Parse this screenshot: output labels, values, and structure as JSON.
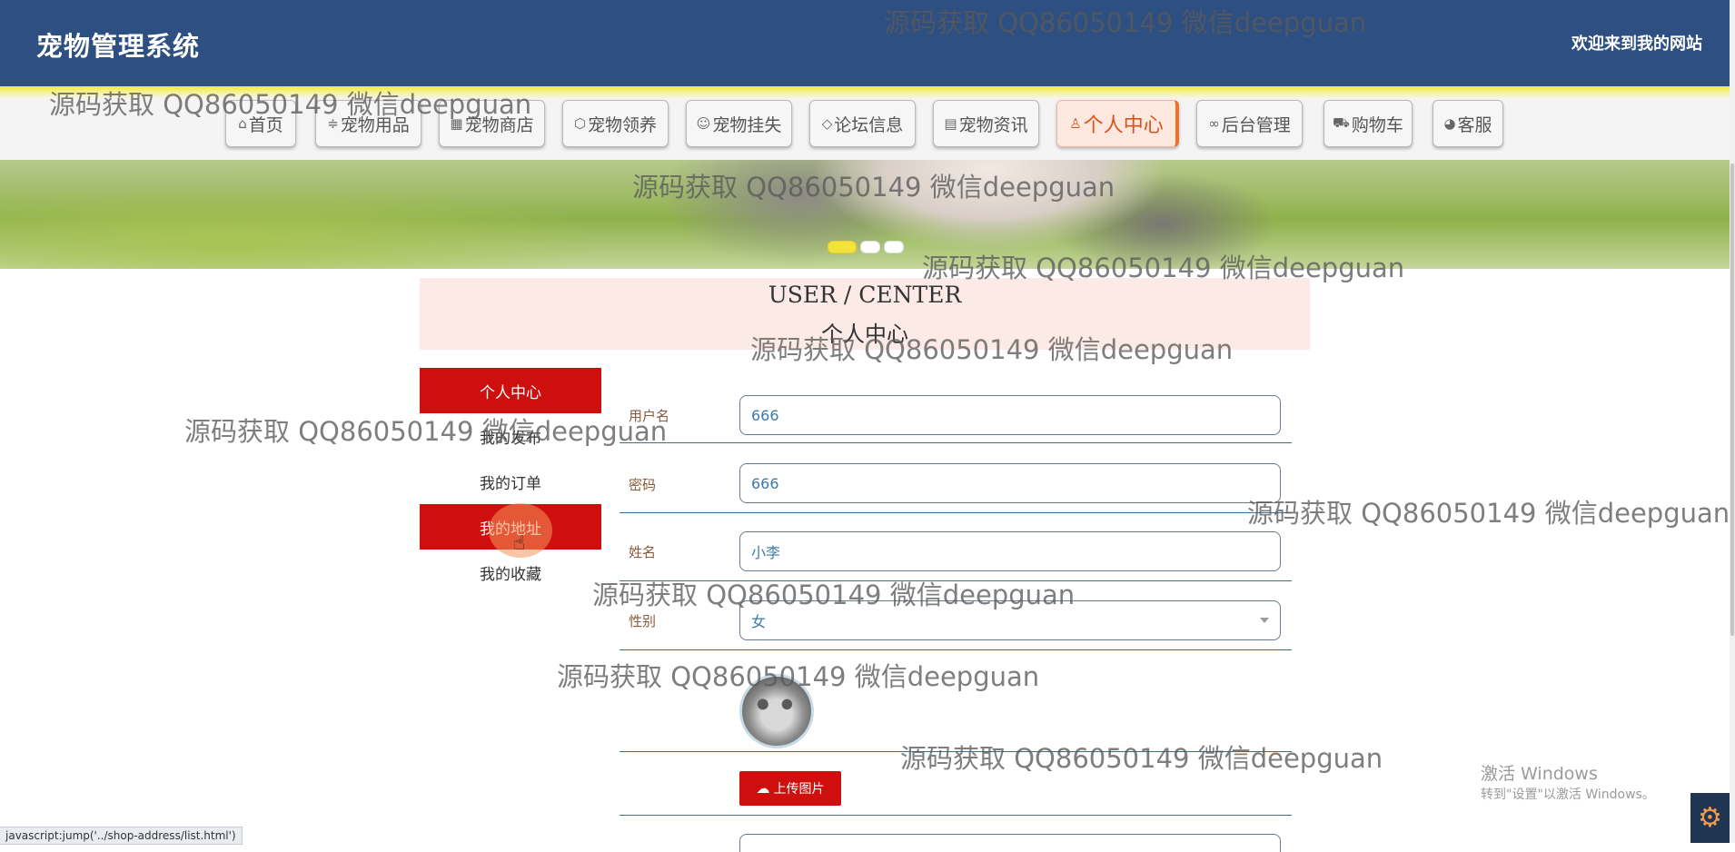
{
  "header": {
    "title": "宠物管理系统",
    "welcome": "欢迎来到我的网站",
    "bg_color": "#2e4f82"
  },
  "nav": {
    "items": [
      {
        "label": "首页",
        "icon": "home-icon",
        "glyph": "⌂"
      },
      {
        "label": "宠物用品",
        "icon": "sliders-icon",
        "glyph": "≑"
      },
      {
        "label": "宠物商店",
        "icon": "store-icon",
        "glyph": "▦"
      },
      {
        "label": "宠物领养",
        "icon": "box-icon",
        "glyph": "⬡"
      },
      {
        "label": "宠物挂失",
        "icon": "pet-face-icon",
        "glyph": "☺"
      },
      {
        "label": "论坛信息",
        "icon": "tag-icon",
        "glyph": "◇"
      },
      {
        "label": "宠物资讯",
        "icon": "document-icon",
        "glyph": "▤"
      },
      {
        "label": "个人中心",
        "icon": "user-icon",
        "glyph": "♙",
        "active": true
      },
      {
        "label": "后台管理",
        "icon": "link-icon",
        "glyph": "∞"
      },
      {
        "label": "购物车",
        "icon": "cart-icon",
        "glyph": "⛟"
      },
      {
        "label": "客服",
        "icon": "chat-icon",
        "glyph": "◕"
      }
    ],
    "active_color": "#d8541e"
  },
  "carousel": {
    "dots": 3,
    "active_index": 0,
    "active_color": "#f3e23a"
  },
  "page_title": {
    "en": "USER / CENTER",
    "cn": "个人中心"
  },
  "side_menu": {
    "items": [
      {
        "label": "个人中心",
        "highlight": true
      },
      {
        "label": "我的发布",
        "highlight": false
      },
      {
        "label": "我的订单",
        "highlight": false
      },
      {
        "label": "我的地址",
        "highlight": true
      },
      {
        "label": "我的收藏",
        "highlight": false
      }
    ],
    "highlight_color": "#cf0e0e"
  },
  "form": {
    "username": {
      "label": "用户名",
      "value": "666"
    },
    "password": {
      "label": "密码",
      "value": "666"
    },
    "name": {
      "label": "姓名",
      "value": "小李"
    },
    "gender": {
      "label": "性别",
      "value": "女"
    },
    "upload_label": "上传图片",
    "upload_icon": "cloud-upload-icon"
  },
  "statusbar": {
    "text": "javascript:jump('../shop-address/list.html')"
  },
  "windows_activation": {
    "line1": "激活 Windows",
    "line2": "转到\"设置\"以激活 Windows。"
  },
  "watermark": {
    "text": "源码获取 QQ86050149 微信deepguan"
  }
}
